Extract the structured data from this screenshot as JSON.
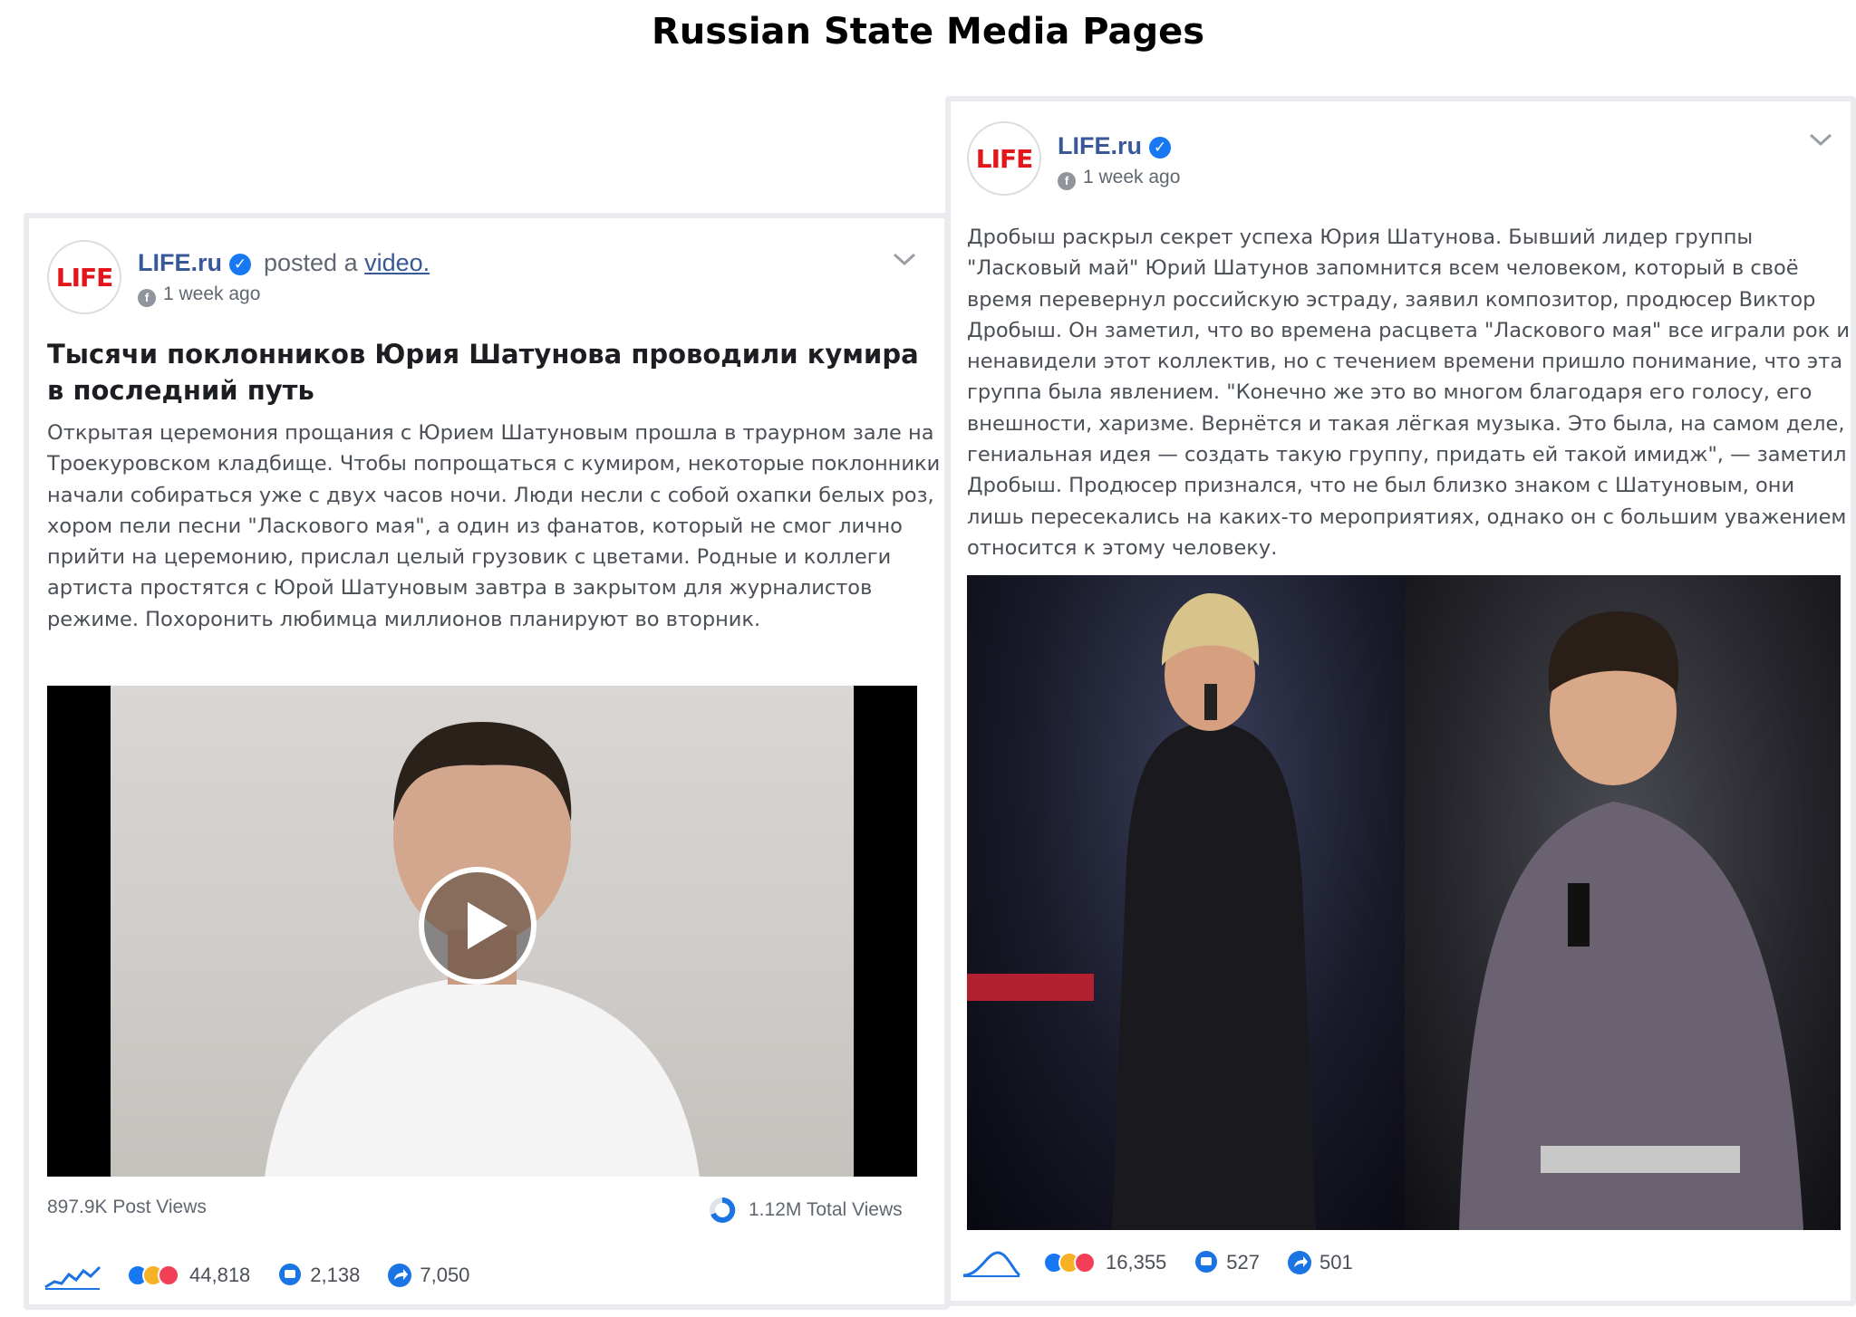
{
  "page_title": "Russian State Media Pages",
  "left_post": {
    "logo_text": "LIFE",
    "page_name": "LIFE.ru",
    "posted_prefix": "posted a",
    "posted_link": "video.",
    "time": "1 week ago",
    "headline": "Тысячи поклонников Юрия Шатунова проводили кумира в последний путь",
    "body": "Открытая церемония прощания с Юрием Шатуновым прошла в траурном зале на Троекуровском кладбище. Чтобы попрощаться с кумиром, некоторые поклонники начали собираться уже с двух часов ночи. Люди несли с собой охапки белых роз, хором пели песни \"Ласкового мая\", а один из фанатов, который не смог лично прийти на церемонию, прислал целый грузовик с цветами. Родные и коллеги артиста простятся с Юрой Шатуновым завтра в закрытом для журналистов режиме. Похоронить любимца миллионов планируют во вторник.",
    "post_views": "897.9K Post Views",
    "total_views": "1.12M Total Views",
    "reactions": "44,818",
    "comments": "2,138",
    "shares": "7,050"
  },
  "right_post": {
    "logo_text": "LIFE",
    "page_name": "LIFE.ru",
    "time": "1 week ago",
    "body": "Дробыш раскрыл секрет успеха Юрия Шатунова. Бывший лидер группы \"Ласковый май\" Юрий Шатунов запомнится всем человеком, который в своё время перевернул российскую эстраду, заявил композитор, продюсер Виктор Дробыш. Он заметил, что во времена расцвета \"Ласкового мая\" все играли рок и ненавидели этот коллектив, но с течением времени пришло понимание, что эта группа была явлением. \"Конечно же это во многом благодаря его голосу, его внешности, харизме. Вернётся и такая лёгкая музыка. Это была, на самом деле, гениальная идея — создать такую группу, придать ей такой имидж\", — заметил Дробыш. Продюсер признался, что не был близко знаком с Шатуновым, они лишь пересекались на каких-то мероприятиях, однако он с большим уважением относится к этому человеку.",
    "reactions": "16,355",
    "comments": "527",
    "shares": "501"
  },
  "colors": {
    "link_blue": "#385898",
    "verified_blue": "#1877f2",
    "logo_red": "#e3161b",
    "like_blue": "#1877f2",
    "sad_yellow": "#f7b125",
    "love_red": "#f33e58"
  },
  "icons": [
    "verified-icon",
    "globe-icon",
    "chevron-down-icon",
    "play-icon",
    "trend-icon",
    "like-icon",
    "sad-icon",
    "love-icon",
    "comment-icon",
    "share-icon",
    "views-ring-icon"
  ]
}
